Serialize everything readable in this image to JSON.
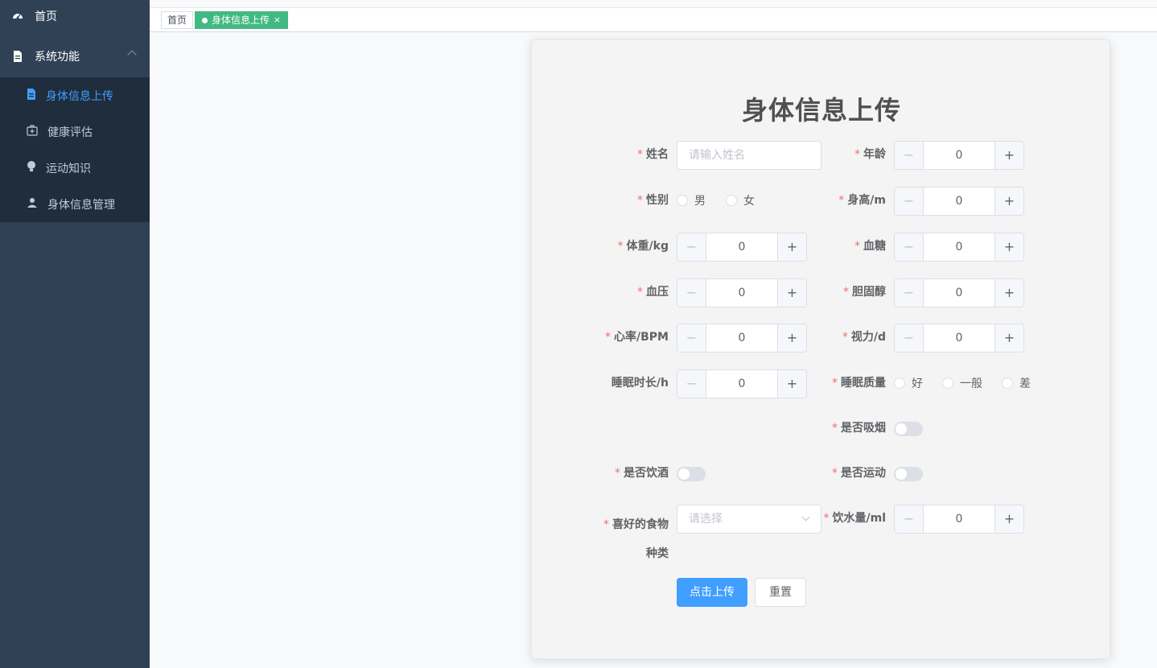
{
  "sidebar": {
    "home_label": "首页",
    "system_label": "系统功能",
    "items": [
      {
        "label": "身体信息上传",
        "icon": "document-icon"
      },
      {
        "label": "健康评估",
        "icon": "medical-box-icon"
      },
      {
        "label": "运动知识",
        "icon": "bulb-icon"
      },
      {
        "label": "身体信息管理",
        "icon": "user-icon"
      }
    ]
  },
  "tags": {
    "home": "首页",
    "active": "身体信息上传",
    "close": "×"
  },
  "form": {
    "title": "身体信息上传",
    "name_label": "姓名",
    "name_placeholder": "请输入姓名",
    "age_label": "年龄",
    "age_value": "0",
    "gender_label": "性别",
    "gender_options": [
      "男",
      "女"
    ],
    "height_label": "身高/m",
    "height_value": "0",
    "weight_label": "体重/kg",
    "weight_value": "0",
    "sugar_label": "血糖",
    "sugar_value": "0",
    "pressure_label": "血压",
    "pressure_value": "0",
    "cholesterol_label": "胆固醇",
    "cholesterol_value": "0",
    "heart_label": "心率/BPM",
    "heart_value": "0",
    "vision_label": "视力/d",
    "vision_value": "0",
    "sleep_label": "睡眠时长/h",
    "sleep_value": "0",
    "quality_label": "睡眠质量",
    "quality_options": [
      "好",
      "一般",
      "差"
    ],
    "smoke_label": "是否吸烟",
    "drink_label": "是否饮酒",
    "exercise_label": "是否运动",
    "food_label_1": "喜好的食物",
    "food_label_2": "种类",
    "food_placeholder": "请选择",
    "water_label": "饮水量/ml",
    "water_value": "0",
    "submit": "点击上传",
    "reset": "重置",
    "required_mark": "*",
    "minus": "−",
    "plus": "+"
  },
  "colors": {
    "sidebar": "#304156",
    "submenu": "#1f2d3d",
    "active": "#409eff",
    "tag_active": "#42b983",
    "required": "#f56c6c"
  }
}
